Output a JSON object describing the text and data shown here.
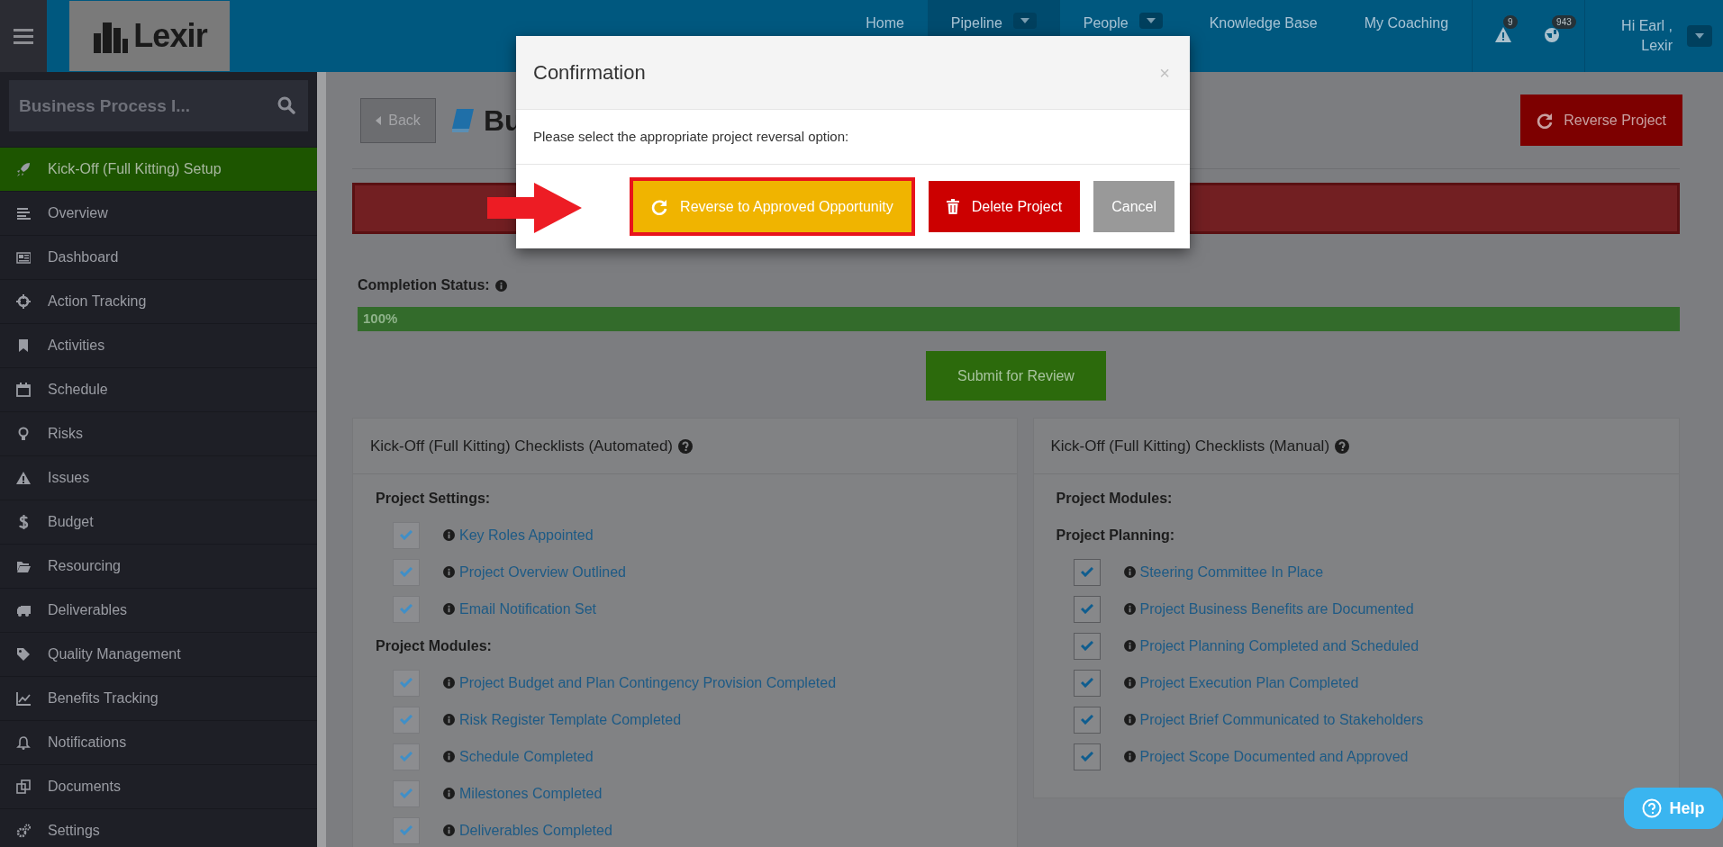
{
  "topbar": {
    "logo": "Lexir",
    "nav": [
      {
        "label": "Home",
        "dropdown": false,
        "selected": false
      },
      {
        "label": "Pipeline",
        "dropdown": true,
        "selected": true
      },
      {
        "label": "People",
        "dropdown": true,
        "selected": false
      },
      {
        "label": "Knowledge Base",
        "dropdown": false,
        "selected": false
      },
      {
        "label": "My Coaching",
        "dropdown": false,
        "selected": false
      }
    ],
    "alerts_badge": "9",
    "notifications_badge": "943",
    "greeting": "Hi Earl ,",
    "user": "Lexir"
  },
  "sidebar": {
    "search_value": "Business Process I...",
    "items": [
      {
        "label": "Kick-Off (Full Kitting) Setup",
        "selected": true
      },
      {
        "label": "Overview",
        "selected": false
      },
      {
        "label": "Dashboard",
        "selected": false
      },
      {
        "label": "Action Tracking",
        "selected": false
      },
      {
        "label": "Activities",
        "selected": false
      },
      {
        "label": "Schedule",
        "selected": false
      },
      {
        "label": "Risks",
        "selected": false
      },
      {
        "label": "Issues",
        "selected": false
      },
      {
        "label": "Budget",
        "selected": false
      },
      {
        "label": "Resourcing",
        "selected": false
      },
      {
        "label": "Deliverables",
        "selected": false
      },
      {
        "label": "Quality Management",
        "selected": false
      },
      {
        "label": "Benefits Tracking",
        "selected": false
      },
      {
        "label": "Notifications",
        "selected": false
      },
      {
        "label": "Documents",
        "selected": false
      },
      {
        "label": "Settings",
        "selected": false
      }
    ]
  },
  "page": {
    "back": "Back",
    "title": "Bu",
    "reverse_button": "Reverse Project",
    "completion_label": "Completion Status:",
    "progress": {
      "level": 1,
      "reading": "100%"
    },
    "submit": "Submit for Review"
  },
  "panels": [
    {
      "title": "Kick-Off (Full Kitting) Checklists (Automated)",
      "sections": [
        {
          "heading": "Project Settings:",
          "items": [
            {
              "label": "Key Roles Appointed",
              "checked": true,
              "disabled": true
            },
            {
              "label": "Project Overview Outlined",
              "checked": true,
              "disabled": true
            },
            {
              "label": "Email Notification Set",
              "checked": true,
              "disabled": true
            }
          ]
        },
        {
          "heading": "Project Modules:",
          "items": [
            {
              "label": "Project Budget and Plan Contingency Provision Completed",
              "checked": true,
              "disabled": true
            },
            {
              "label": "Risk Register Template Completed",
              "checked": true,
              "disabled": true
            },
            {
              "label": "Schedule Completed",
              "checked": true,
              "disabled": true
            },
            {
              "label": "Milestones Completed",
              "checked": true,
              "disabled": true
            },
            {
              "label": "Deliverables Completed",
              "checked": true,
              "disabled": true
            }
          ]
        }
      ]
    },
    {
      "title": "Kick-Off (Full Kitting) Checklists (Manual)",
      "sections": [
        {
          "heading": "Project Modules:"
        },
        {
          "heading": "Project Planning:",
          "items": [
            {
              "label": "Steering Committee In Place",
              "checked": true,
              "disabled": false
            },
            {
              "label": "Project Business Benefits are Documented",
              "checked": true,
              "disabled": false
            },
            {
              "label": "Project Planning Completed and Scheduled",
              "checked": true,
              "disabled": false
            },
            {
              "label": "Project Execution Plan Completed",
              "checked": true,
              "disabled": false
            },
            {
              "label": "Project Brief Communicated to Stakeholders",
              "checked": true,
              "disabled": false
            },
            {
              "label": "Project Scope Documented and Approved",
              "checked": true,
              "disabled": false
            }
          ]
        }
      ]
    }
  ],
  "modal": {
    "title": "Confirmation",
    "close": "×",
    "message": "Please select the appropriate project reversal option:",
    "buttons": [
      {
        "label": "Reverse to Approved Opportunity",
        "kind": "warning",
        "highlighted": true
      },
      {
        "label": "Delete Project",
        "kind": "danger",
        "highlighted": false
      },
      {
        "label": "Cancel",
        "kind": "default",
        "highlighted": false
      }
    ]
  },
  "help": "Help"
}
